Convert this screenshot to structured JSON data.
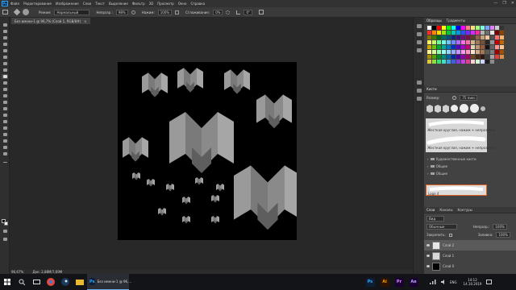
{
  "menubar": {
    "logo": "Ps",
    "items": [
      "Файл",
      "Редактирование",
      "Изображение",
      "Слои",
      "Текст",
      "Выделение",
      "Фильтр",
      "3D",
      "Просмотр",
      "Окно",
      "Справка"
    ],
    "controls": [
      "—",
      "❐",
      "✕"
    ]
  },
  "options": {
    "mode_label": "Режим:",
    "mode_value": "Нормальный",
    "opacity_label": "Непрозр.:",
    "opacity_value": "98%",
    "pressure_label": "Нажим:",
    "pressure_value": "100%",
    "smoothing_label": "Сглаживание:",
    "smoothing_value": "0%",
    "angle_value": "0°"
  },
  "document": {
    "tab_title": "Без имени-1 @ 96,7% (Слой 1, RGB/8#)",
    "close": "×",
    "status": "96,67%",
    "doc_size": "Док: 2,88M/7,69M"
  },
  "panels": {
    "swatches_tabs": [
      "Образцы",
      "Градиенты"
    ],
    "brushes_title": "Кисти",
    "size_label": "Размер:",
    "size_value": "75 пикс.",
    "brush_rows": [
      "Жесткая круглая, нажим + непрозрачн.",
      "Жесткая круглая, нажим + непрозрачн."
    ],
    "folders": [
      "Художественные кисти",
      "Общие",
      "Общие"
    ],
    "selected_brush": "Logo 4",
    "layers_tabs": [
      "Слои",
      "Каналы",
      "Контуры"
    ],
    "filter_label": "Вид",
    "blend_value": "Обычные",
    "opacity_label": "Непрозр.:",
    "opacity_value": "100%",
    "lock_label": "Закрепить:",
    "fill_label": "Заливка:",
    "fill_value": "100%",
    "layers": [
      "Слой 2",
      "Слой 1",
      "Слой 0"
    ]
  },
  "swatch_colors": [
    "#ffffff",
    "#000000",
    "#ff0000",
    "#ffff00",
    "#00ff00",
    "#00ffff",
    "#0000ff",
    "#ff00ff",
    "#ff8080",
    "#ffe080",
    "#a0ff80",
    "#80ffe0",
    "#80a0ff",
    "#e080ff",
    "#cccccc",
    "#333333",
    "#ff2a2a",
    "#ff8a00",
    "#ffd800",
    "#9ae600",
    "#00c83c",
    "#00c8b4",
    "#009be6",
    "#2a50ff",
    "#7a2aff",
    "#d22aff",
    "#ff2a9a",
    "#b4b4b4",
    "#6e6e6e",
    "#e6e6e6",
    "#7a0000",
    "#8a4400",
    "#8a7400",
    "#3c7a00",
    "#00641e",
    "#006a5e",
    "#004e7a",
    "#10287a",
    "#3e107a",
    "#6a107a",
    "#7a1048",
    "#5a3c28",
    "#8c6446",
    "#c8a07a",
    "#f0c8a0",
    "#505050",
    "#ff6e6e",
    "#ffb46e",
    "#fff06e",
    "#c8ff6e",
    "#6eff96",
    "#6effe6",
    "#6ec8ff",
    "#6e8cff",
    "#aa6eff",
    "#ff6ee6",
    "#ff6ea8",
    "#d2b48c",
    "#a0785a",
    "#785032",
    "#282828",
    "#969696",
    "#c80000",
    "#c86400",
    "#c8aa00",
    "#64c800",
    "#00aa32",
    "#00aa96",
    "#0078c8",
    "#0032c8",
    "#5a00c8",
    "#aa00c8",
    "#c80078",
    "#e6d2b4",
    "#be9670",
    "#965a3c",
    "#141414",
    "#646464",
    "#ff9696",
    "#ffc896",
    "#fff596",
    "#d2ff96",
    "#96ffb4",
    "#96fff0",
    "#96d7ff",
    "#96aaff",
    "#c396ff",
    "#ff96f0",
    "#ff96c3",
    "#fae6d2",
    "#d2aa82",
    "#aa7850",
    "#5a5a5a",
    "#7d7d7d",
    "#a50000",
    "#a55000",
    "#a58c00",
    "#50a500",
    "#008c28",
    "#008c78",
    "#0064a5",
    "#0028a5",
    "#4600a5",
    "#8c00a5",
    "#a50064",
    "#6e4628",
    "#462814",
    "#32190a",
    "#3c3c3c",
    "#a5a5a5",
    "#e04040",
    "#e09040",
    "#e0c840",
    "#90e040",
    "#40e070",
    "#40e0c8",
    "#40a0e0",
    "#4060e0",
    "#8040e0",
    "#c840e0",
    "#e04090",
    "#ffd2d2",
    "#d2ffd2",
    "#d2d2ff",
    "#1e1e1e",
    "#8c8c8c"
  ],
  "taskbar": {
    "apps": [
      "Ps",
      "Ai",
      "Pr",
      "Ae"
    ],
    "window_title": "Без имени-1 @ 96,...",
    "lang": "ENG",
    "time": "14:12",
    "date": "14.10.2019"
  }
}
